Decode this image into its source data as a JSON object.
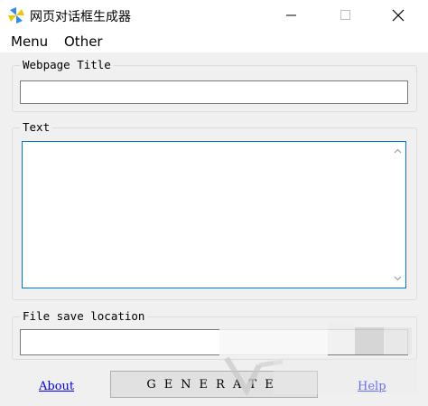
{
  "window": {
    "title": "网页对话框生成器",
    "min_label": "—",
    "max_label": "□",
    "close_label": "✕"
  },
  "menu": {
    "items": [
      {
        "label": "Menu"
      },
      {
        "label": "Other"
      }
    ]
  },
  "form": {
    "title_group": "Webpage Title",
    "title_value": "",
    "text_group": "Text",
    "text_value": "",
    "save_group": "File save location",
    "save_value": ""
  },
  "footer": {
    "about": "About",
    "generate": "GENERATE",
    "help": "Help"
  },
  "colors": {
    "focus_border": "#0078d7",
    "link": "#0000ee"
  },
  "icons": [
    "app-pinwheel-icon",
    "minimize-icon",
    "maximize-icon",
    "close-icon",
    "scroll-up-icon",
    "scroll-down-icon"
  ]
}
